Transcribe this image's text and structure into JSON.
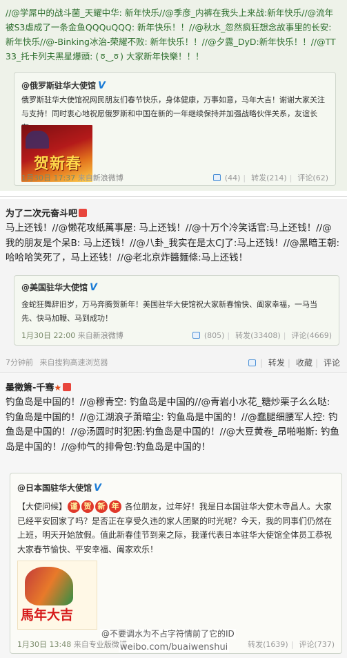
{
  "post1": {
    "text": "//@学屌中的战斗菌_天耀中华: 新年快乐//@季彦_内裤在我头上来战:新年快乐//@流年被S3虐成了一条金鱼QQQuQQQ: 新年快乐！！//@秋水_忽然疯狂想念故事里的长安: 新年快乐//@-Binking冰治-荣耀不败: 新年快乐！！//@夕露_DyD:新年快乐！！//@TT33_托卡列夫黑星爆頭: (ㆆ ͜ ㆆ) 大家新年快樂！！！",
    "quote": {
      "author": "@俄罗斯驻华大使馆",
      "verified": "V",
      "text": "俄罗斯驻华大使馆祝网民朋友们春节快乐，身体健康，万事如意，马年大吉！谢谢大家关注与支持！同时衷心地祝愿俄罗斯和中国在新的一年继续保持并加强战略伙伴关系，友谊长存。",
      "image_alt": "贺新春",
      "date": "1月30日 17:37",
      "source_prefix": "来自",
      "source": "新浪微博",
      "likes": "(44)",
      "repost": "转发(214)",
      "comment": "评论(62)"
    }
  },
  "post2": {
    "author": "为了二次元奋斗吧",
    "text": "马上还钱！//@懒花攻紙萬事屋: 马上还钱！//@十万个冷笑话官:马上还钱！//@我的朋友是个呆B: 马上还钱！//@八卦_我实在是太CJ了:马上还钱！//@黑暗王朝:哈哈哈笑死了，马上还钱！//@老北京炸醬麵條:马上还钱！",
    "quote": {
      "author": "@美国驻华大使馆",
      "verified": "V",
      "text": "金蛇狂舞辞旧岁，万马奔腾贺新年！美国驻华大使馆祝大家新春愉快、阖家幸福，一马当先、快马加鞭、马到成功！",
      "date": "1月30日 22:00",
      "source_prefix": "来自",
      "source": "新浪微博",
      "likes": "(805)",
      "repost": "转发(33408)",
      "comment": "评论(4669)"
    },
    "time": "7分钟前",
    "client": "来自搜狗高速浏览器",
    "actions": {
      "repost": "转发",
      "favorite": "收藏",
      "comment": "评论"
    }
  },
  "post3": {
    "author": "墨徵箫-千骞",
    "text": "钓鱼岛是中国的！//@穆青空: 钓鱼岛是中国的//@青岩小水花_糖炒栗子么么哒: 钓鱼岛是中国的！//@江湖浪子萧暗尘: 钓鱼岛是中国的！//@蠢腿细腰军人控: 钓鱼岛是中国的！//@汤圆时时犯困:钓鱼岛是中国的！//@大豆黄卷_昂啪啪斯: 钓鱼岛是中国的！//@帅气的排骨包:钓鱼岛是中国的！",
    "quote": {
      "author": "@日本国驻华大使馆",
      "verified": "V",
      "text_before": "【大使问候】",
      "tags": [
        "谨",
        "贺",
        "新",
        "年"
      ],
      "text_after": " 各位朋友，过年好！我是日本国驻华大使木寺昌人。大家已经平安回家了吗？是否正在享受久违的家人团聚的时光呢？今天，我的同事们仍然在上班，明天开始放假。值此新春佳节到来之际，我谨代表日本驻华大使馆全体员工恭祝大家春节愉快、平安幸福、阖家欢乐！",
      "image_text": "馬年大吉",
      "date": "1月30日 13:48",
      "source_prefix": "来自",
      "source": "专业版微博",
      "repost": "转发(1639)",
      "comment": "评论(737)"
    }
  },
  "watermark": {
    "line1": "@不要调水为不占字符情前了它的ID",
    "line2": "weibo.com/buaiwenshui"
  }
}
